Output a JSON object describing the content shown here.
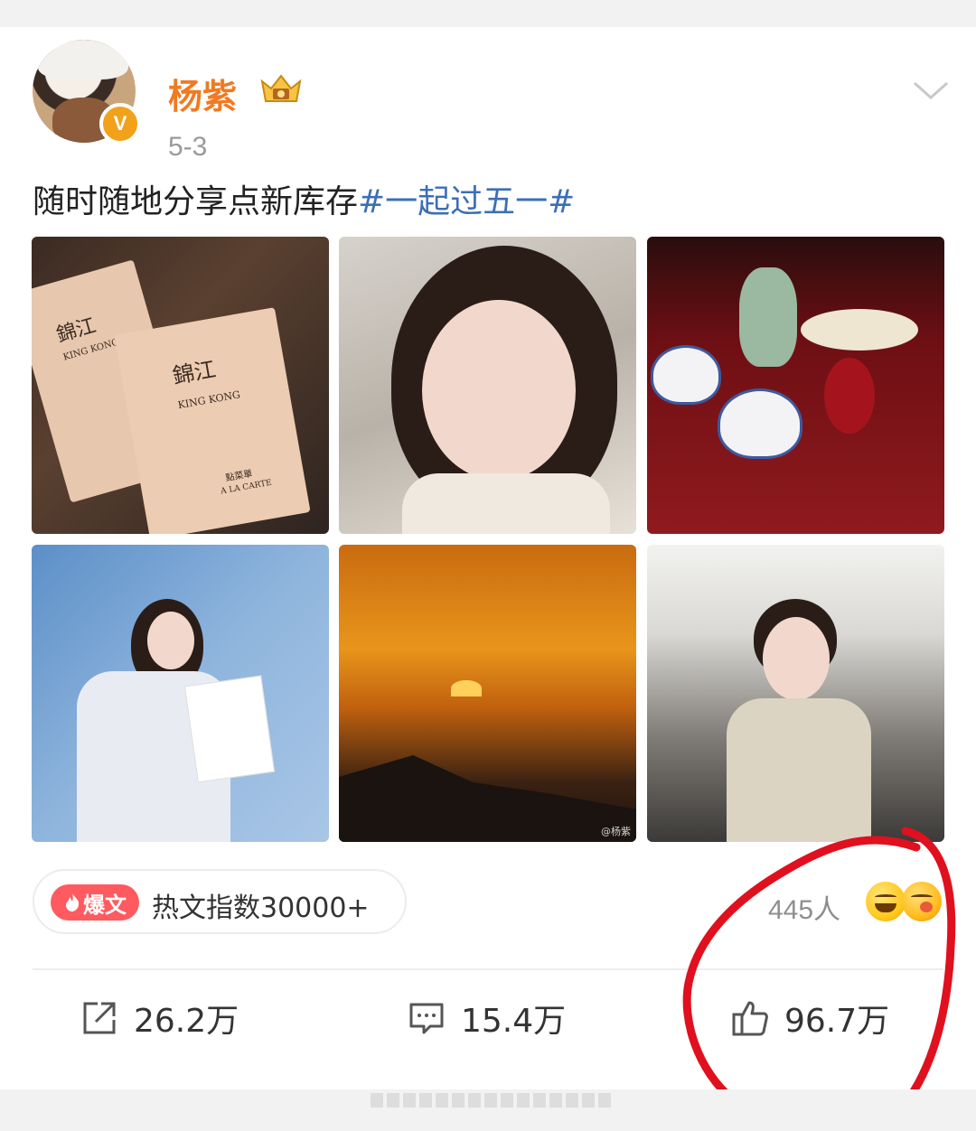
{
  "post": {
    "author": "杨紫",
    "verified_badge": "V",
    "date": "5-3",
    "text": "随时随地分享点新库存",
    "hashtag": "#一起过五一#"
  },
  "photos": {
    "p1_title": "錦江",
    "p1_sub": "KING KONG",
    "p1_title2": "錦江",
    "p1_sub2": "KING KONG",
    "p1_menu": "點菜單",
    "p1_carte": "A LA CARTE",
    "p5_watermark": "@杨紫"
  },
  "hot": {
    "badge": "爆文",
    "text": "热文指数30000+"
  },
  "reactions": {
    "count": "445人"
  },
  "actions": {
    "share": "26.2万",
    "comment": "15.4万",
    "like": "96.7万"
  },
  "colors": {
    "username": "#f07a22",
    "hashtag": "#3c6fb5",
    "hot_badge": "#ff5a5f",
    "annotation": "#e0101e"
  }
}
